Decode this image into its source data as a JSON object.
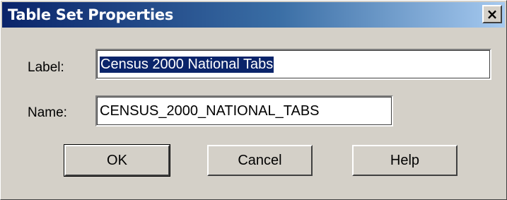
{
  "window": {
    "title": "Table Set Properties",
    "close_label": "×"
  },
  "form": {
    "label_caption": "Label:",
    "label_value": "Census 2000 National Tabs",
    "name_caption": "Name:",
    "name_value": "CENSUS_2000_NATIONAL_TABS"
  },
  "buttons": {
    "ok": "OK",
    "cancel": "Cancel",
    "help": "Help"
  },
  "colors": {
    "title_gradient_start": "#0a246a",
    "title_gradient_end": "#a6caf0",
    "dialog_face": "#d4d0c8",
    "selection": "#0a246a"
  }
}
